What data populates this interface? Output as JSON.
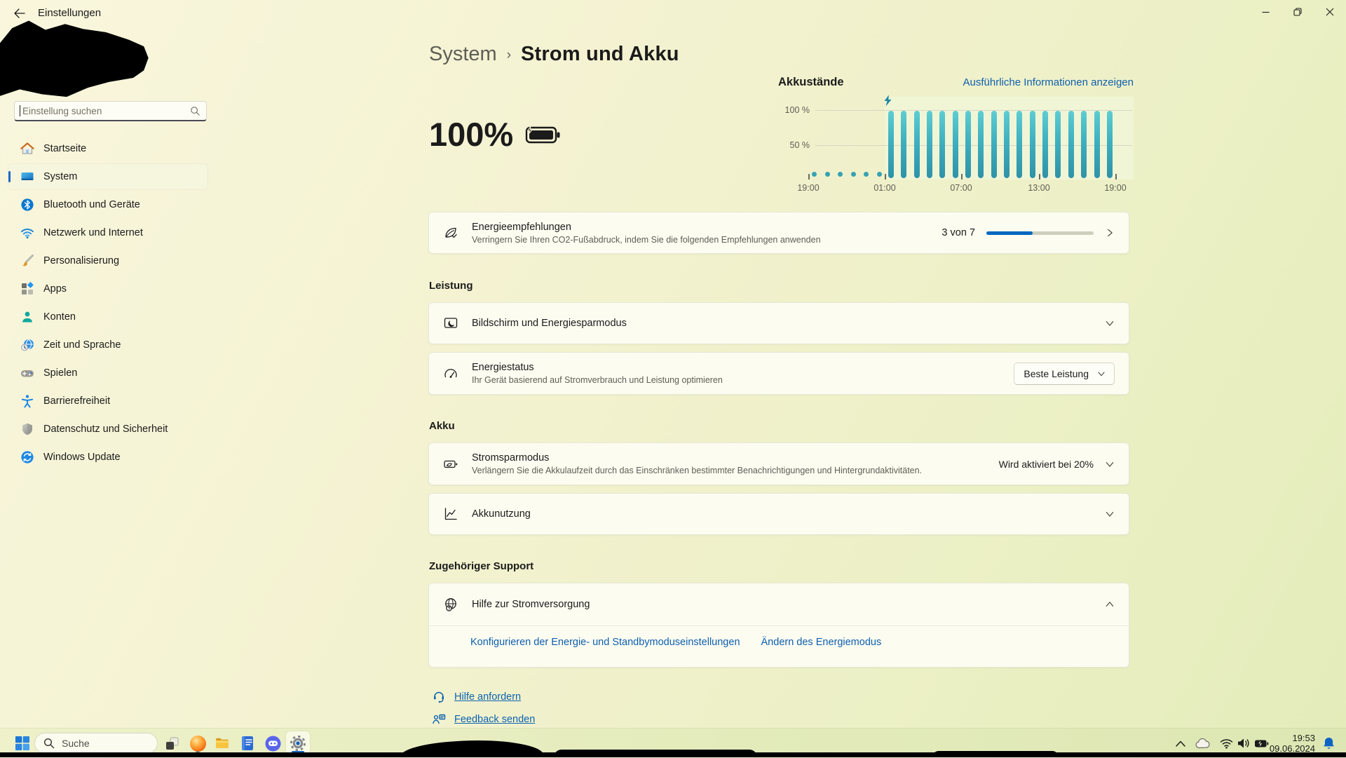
{
  "window": {
    "title": "Einstellungen",
    "controls": {
      "minimize": "minimize",
      "restore": "restore",
      "close": "close"
    }
  },
  "sidebar": {
    "search_placeholder": "Einstellung suchen",
    "items": [
      {
        "label": "Startseite",
        "icon": "home-icon",
        "selected": false
      },
      {
        "label": "System",
        "icon": "system-icon",
        "selected": true
      },
      {
        "label": "Bluetooth und Geräte",
        "icon": "bluetooth-icon",
        "selected": false
      },
      {
        "label": "Netzwerk und Internet",
        "icon": "network-icon",
        "selected": false
      },
      {
        "label": "Personalisierung",
        "icon": "personalization-icon",
        "selected": false
      },
      {
        "label": "Apps",
        "icon": "apps-icon",
        "selected": false
      },
      {
        "label": "Konten",
        "icon": "accounts-icon",
        "selected": false
      },
      {
        "label": "Zeit und Sprache",
        "icon": "time-language-icon",
        "selected": false
      },
      {
        "label": "Spielen",
        "icon": "gaming-icon",
        "selected": false
      },
      {
        "label": "Barrierefreiheit",
        "icon": "accessibility-icon",
        "selected": false
      },
      {
        "label": "Datenschutz und Sicherheit",
        "icon": "privacy-icon",
        "selected": false
      },
      {
        "label": "Windows Update",
        "icon": "windows-update-icon",
        "selected": false
      }
    ]
  },
  "header": {
    "breadcrumb_parent": "System",
    "breadcrumb_separator": "›",
    "page_title": "Strom und Akku",
    "battery_percent": "100%"
  },
  "chart": {
    "type": "bar",
    "title": "Akkustände",
    "link": "Ausführliche Informationen anzeigen",
    "y_ticks": [
      "100 %",
      "50 %"
    ],
    "x_ticks": [
      "19:00",
      "01:00",
      "07:00",
      "13:00",
      "19:00"
    ],
    "dots_count": 6,
    "bars_count": 18,
    "bar_value_percent": 100,
    "charging_marker": "lightning-bolt at 01:00",
    "bar_color": "#35a2b2",
    "ylim": [
      0,
      100
    ]
  },
  "recommendations": {
    "title": "Energieempfehlungen",
    "subtitle": "Verringern Sie Ihren CO2-Fußabdruck, indem Sie die folgenden Empfehlungen anwenden",
    "count_label": "3 von 7",
    "progress_value": 3,
    "progress_max": 7,
    "progress_color": "#0067c0"
  },
  "sections": {
    "leistung": {
      "heading": "Leistung",
      "display_card": {
        "title": "Bildschirm und Energiesparmodus"
      },
      "energy_card": {
        "title": "Energiestatus",
        "subtitle": "Ihr Gerät basierend auf Stromverbrauch und Leistung optimieren",
        "dropdown_value": "Beste Leistung"
      }
    },
    "akku": {
      "heading": "Akku",
      "saver_card": {
        "title": "Stromsparmodus",
        "subtitle": "Verlängern Sie die Akkulaufzeit durch das Einschränken bestimmter Benachrichtigungen und Hintergrundaktivitäten.",
        "status": "Wird aktiviert bei 20%"
      },
      "usage_card": {
        "title": "Akkunutzung"
      }
    },
    "support": {
      "heading": "Zugehöriger Support",
      "help_card": {
        "title": "Hilfe zur Stromversorgung",
        "links": [
          "Konfigurieren der Energie- und Standbymoduseinstellungen",
          "Ändern des Energiemodus"
        ]
      }
    }
  },
  "footer_links": {
    "help": "Hilfe anfordern",
    "feedback": "Feedback senden"
  },
  "taskbar": {
    "search_placeholder": "Suche",
    "tray": {
      "time": "19:53",
      "date": "09.06.2024"
    }
  }
}
